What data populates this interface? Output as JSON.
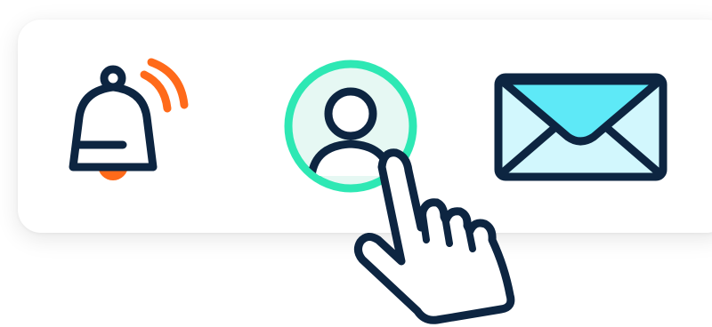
{
  "colors": {
    "outline": "#0d2541",
    "accent_orange": "#ff6a1a",
    "accent_green": "#2ee8b4",
    "avatar_fill": "#e6f8f3",
    "mail_top": "#5ee9f7",
    "mail_body": "#d2f7fd",
    "card": "#ffffff"
  },
  "toolbar": {
    "items": [
      {
        "name": "notifications",
        "icon": "bell-icon",
        "state": "ringing"
      },
      {
        "name": "profile",
        "icon": "user-icon",
        "state": "selected"
      },
      {
        "name": "messages",
        "icon": "envelope-icon",
        "state": "default"
      }
    ]
  },
  "cursor": {
    "icon": "hand-pointer-icon"
  }
}
